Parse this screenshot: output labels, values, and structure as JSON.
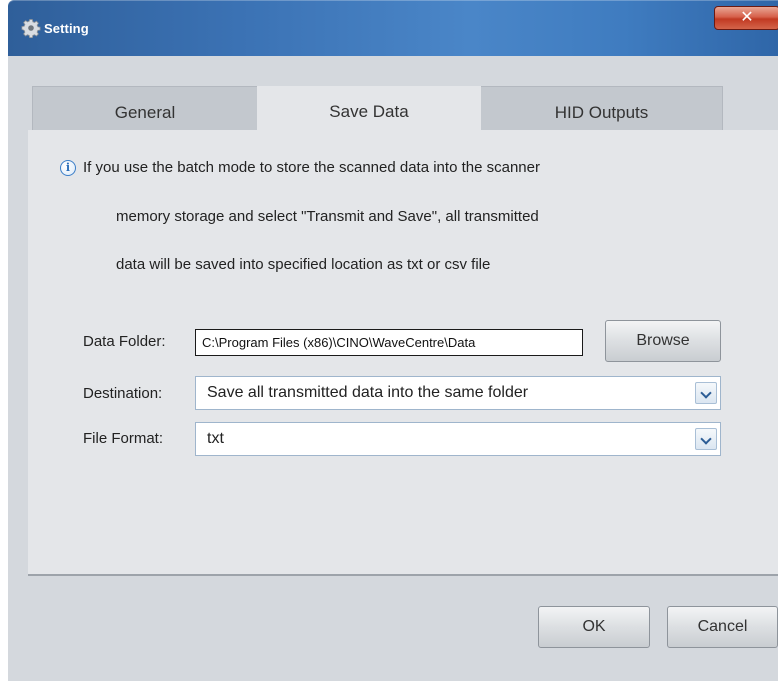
{
  "window": {
    "title": "Setting",
    "close_label": "✕"
  },
  "tabs": [
    {
      "label": "General",
      "active": false
    },
    {
      "label": "Save Data",
      "active": true
    },
    {
      "label": "HID Outputs",
      "active": false
    }
  ],
  "info": {
    "icon": "info-icon",
    "lines": [
      "If you use the batch mode to store the scanned data into the scanner",
      "memory storage and select \"Transmit and Save\", all transmitted",
      "data will be saved into specified location as txt or csv file"
    ]
  },
  "data_folder": {
    "label": "Data Folder:",
    "value": "C:\\Program Files (x86)\\CINO\\WaveCentre\\Data",
    "browse_label": "Browse"
  },
  "destination": {
    "label": "Destination:",
    "selected": "Save all transmitted data into the same folder"
  },
  "file_format": {
    "label": "File Format:",
    "selected": "txt"
  },
  "footer": {
    "ok_label": "OK",
    "cancel_label": "Cancel"
  },
  "colors": {
    "titlebar": "#3b72b4",
    "close_button": "#c13a22",
    "panel": "#e4e6e9",
    "client": "#d4d8dd"
  }
}
